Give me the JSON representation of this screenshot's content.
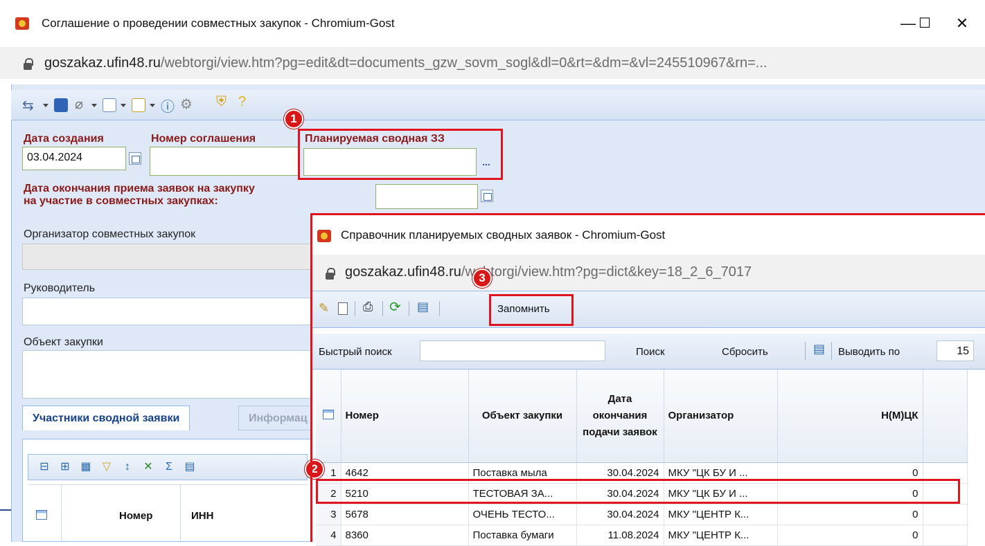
{
  "main_window": {
    "title": "Соглашение о проведении совместных закупок - Chromium-Gost",
    "controls": {
      "minimize": "—",
      "maximize": "☐",
      "close": "✕"
    },
    "url_host": "goszakaz.ufin48.ru",
    "url_path": "/webtorgi/view.htm?pg=edit&dt=documents_gzw_sovm_sogl&dl=0&rt=&dm=&vl=245510967&rn=..."
  },
  "form": {
    "date_created_label": "Дата создания",
    "date_created_value": "03.04.2024",
    "agreement_number_label": "Номер соглашения",
    "agreement_number_value": "",
    "planned_request_label": "Планируемая сводная ЗЗ",
    "planned_request_value": "",
    "dots": "...",
    "deadline_label_line1": "Дата окончания приема заявок на закупку",
    "deadline_label_line2": "на участие в совместных закупках:",
    "deadline_value": "",
    "organizer_label": "Организатор совместных закупок",
    "organizer_value": "",
    "manager_label": "Руководитель",
    "manager_value": "",
    "object_label": "Объект закупки",
    "object_value": ""
  },
  "tabs": [
    {
      "label": "Участники сводной заявки",
      "active": true
    },
    {
      "label": "Информац",
      "active": false
    }
  ],
  "participants_grid": {
    "columns": [
      "Номер",
      "ИНН"
    ]
  },
  "badges": [
    "1",
    "2",
    "3"
  ],
  "dialog": {
    "title": "Справочник планируемых сводных заявок - Chromium-Gost",
    "url_host": "goszakaz.ufin48.ru",
    "url_path": "/webtorgi/view.htm?pg=dict&key=18_2_6_7017",
    "remember_button": "Запомнить",
    "quick_search_label": "Быстрый поиск",
    "quick_search_value": "",
    "search_button": "Поиск",
    "reset_button": "Сбросить",
    "page_size_label": "Выводить по",
    "page_size_value": "15",
    "columns": [
      "Номер",
      "Объект закупки",
      "Дата окончания подачи заявок",
      "Организатор",
      "Н(М)ЦК"
    ],
    "rows": [
      {
        "n": "1",
        "number": "4642",
        "object": "Поставка мыла",
        "date": "30.04.2024",
        "organizer": "МКУ \"ЦК БУ И ...",
        "price": "0"
      },
      {
        "n": "2",
        "number": "5210",
        "object": "ТЕСТОВАЯ ЗА...",
        "date": "30.04.2024",
        "organizer": "МКУ \"ЦК БУ И ...",
        "price": "0"
      },
      {
        "n": "3",
        "number": "5678",
        "object": "ОЧЕНЬ ТЕСТО...",
        "date": "30.04.2024",
        "organizer": "МКУ \"ЦЕНТР К...",
        "price": "0"
      },
      {
        "n": "4",
        "number": "8360",
        "object": "Поставка бумаги",
        "date": "11.08.2024",
        "organizer": "МКУ \"ЦЕНТР К...",
        "price": "0"
      }
    ]
  }
}
